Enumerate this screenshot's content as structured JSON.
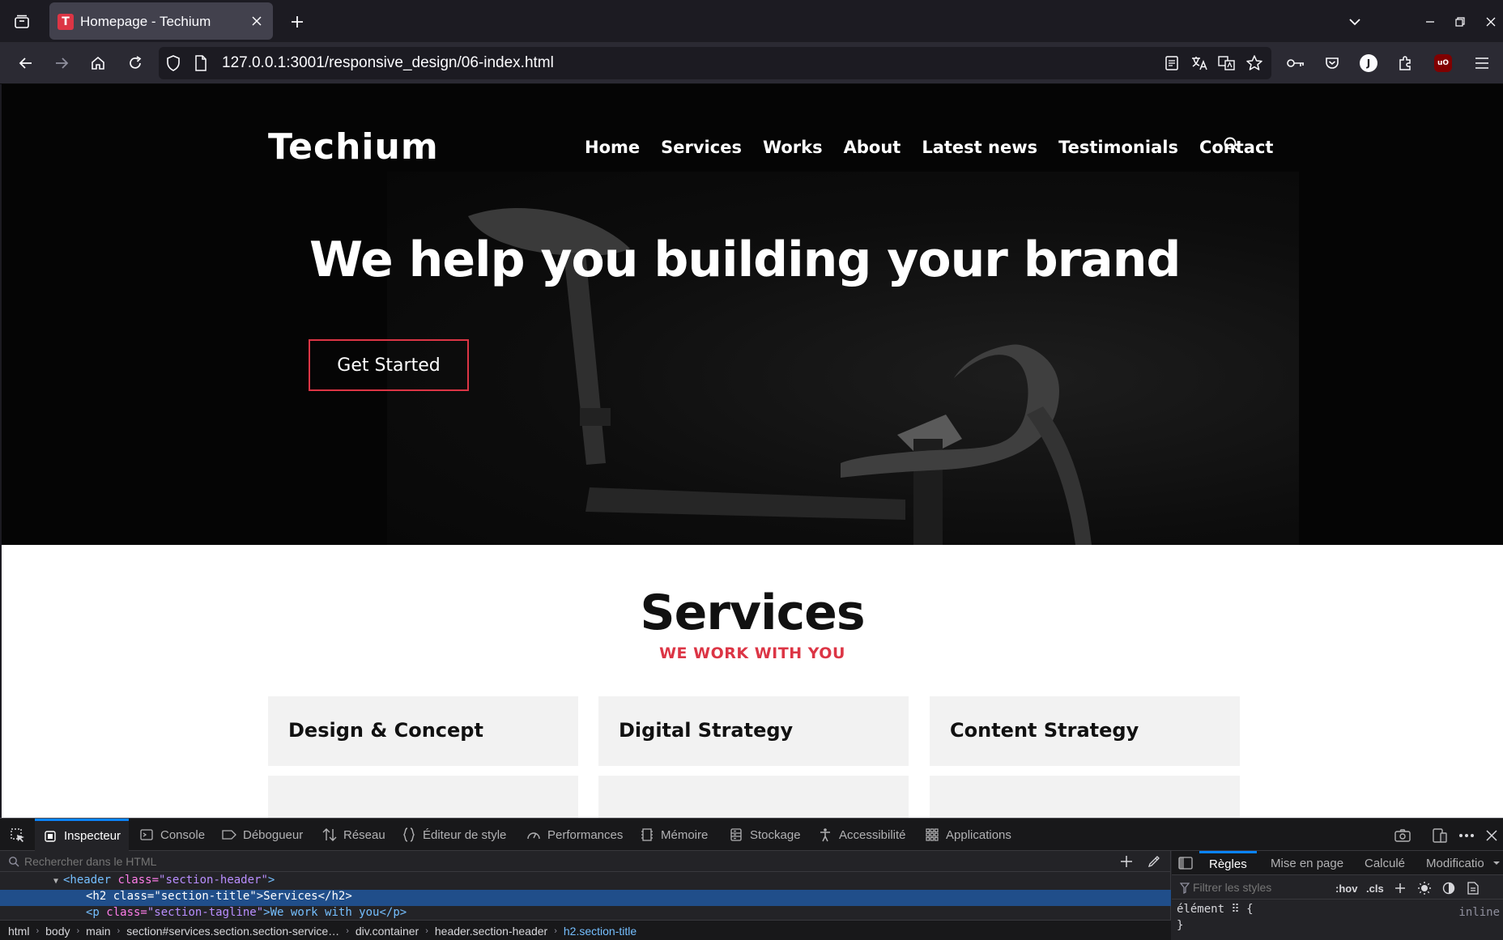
{
  "browser": {
    "tab": {
      "title": "Homepage - Techium",
      "favicon_letter": "T"
    },
    "url": "127.0.0.1:3001/responsive_design/06-index.html"
  },
  "site": {
    "logo": "Techium",
    "nav": [
      "Home",
      "Services",
      "Works",
      "About",
      "Latest news",
      "Testimonials",
      "Contact"
    ],
    "hero": {
      "title": "We help you building your brand",
      "cta": "Get Started"
    },
    "services": {
      "title": "Services",
      "tagline": "WE WORK WITH YOU",
      "cards": [
        "Design & Concept",
        "Digital Strategy",
        "Content Strategy"
      ]
    },
    "colors": {
      "accent": "#dc3545",
      "hero_bg": "#050505",
      "card_bg": "#f2f2f2"
    }
  },
  "devtools": {
    "tabs": [
      "Inspecteur",
      "Console",
      "Débogueur",
      "Réseau",
      "Éditeur de style",
      "Performances",
      "Mémoire",
      "Stockage",
      "Accessibilité",
      "Applications"
    ],
    "search_placeholder": "Rechercher dans le HTML",
    "tree": [
      {
        "tag_open": "<header",
        "attr": " class=",
        "val": "\"section-header\"",
        "tail": ">"
      },
      {
        "tag_open": "<h2",
        "attr": " class=",
        "val": "\"section-title\"",
        "tail": ">Services</h2>"
      },
      {
        "tag_open": "<p",
        "attr": " class=",
        "val": "\"section-tagline\"",
        "tail": ">We work with you</p>"
      }
    ],
    "breadcrumbs": [
      "html",
      "body",
      "main",
      "section#services.section.section-service…",
      "div.container",
      "header.section-header",
      "h2.section-title"
    ],
    "rules_tabs": [
      "Règles",
      "Mise en page",
      "Calculé",
      "Modificatio"
    ],
    "filter_placeholder": "Filtrer les styles",
    "hov_label": ":hov",
    "cls_label": ".cls",
    "rule_selector": "élément ⠿ {",
    "rule_close": "}",
    "rule_inline": "inline"
  }
}
